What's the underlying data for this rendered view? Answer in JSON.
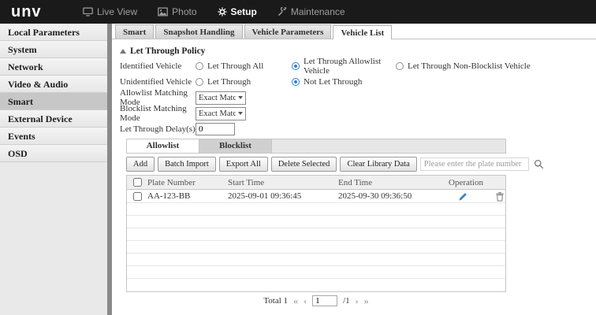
{
  "topbar": {
    "logo": "unv",
    "nav": [
      {
        "label": "Live View"
      },
      {
        "label": "Photo"
      },
      {
        "label": "Setup"
      },
      {
        "label": "Maintenance"
      }
    ]
  },
  "sidebar": {
    "items": [
      {
        "label": "Local Parameters"
      },
      {
        "label": "System"
      },
      {
        "label": "Network"
      },
      {
        "label": "Video & Audio"
      },
      {
        "label": "Smart"
      },
      {
        "label": "External Device"
      },
      {
        "label": "Events"
      },
      {
        "label": "OSD"
      }
    ]
  },
  "tabs": [
    {
      "label": "Smart"
    },
    {
      "label": "Snapshot Handling"
    },
    {
      "label": "Vehicle Parameters"
    },
    {
      "label": "Vehicle List"
    }
  ],
  "policy": {
    "title": "Let Through Policy",
    "identified": {
      "label": "Identified Vehicle",
      "options": [
        {
          "label": "Let Through All",
          "selected": false
        },
        {
          "label": "Let Through Allowlist Vehicle",
          "selected": true
        },
        {
          "label": "Let Through Non-Blocklist Vehicle",
          "selected": false
        }
      ]
    },
    "unidentified": {
      "label": "Unidentified Vehicle",
      "options": [
        {
          "label": "Let Through",
          "selected": false
        },
        {
          "label": "Not Let Through",
          "selected": true
        }
      ]
    },
    "allowlist_mode": {
      "label": "Allowlist Matching Mode",
      "value": "Exact Match"
    },
    "blocklist_mode": {
      "label": "Blocklist Matching Mode",
      "value": "Exact Match"
    },
    "delay": {
      "label": "Let Through Delay(s)",
      "value": "0"
    }
  },
  "list": {
    "tabs": [
      {
        "label": "Allowlist"
      },
      {
        "label": "Blocklist"
      }
    ],
    "toolbar": {
      "add": "Add",
      "batch_import": "Batch Import",
      "export_all": "Export All",
      "delete_selected": "Delete Selected",
      "clear_library": "Clear Library Data",
      "search_placeholder": "Please enter the plate number"
    },
    "table": {
      "headers": {
        "plate": "Plate Number",
        "start": "Start Time",
        "end": "End Time",
        "operation": "Operation"
      },
      "rows": [
        {
          "plate": "AA-123-BB",
          "start": "2025-09-01 09:36:45",
          "end": "2025-09-30 09:36:50"
        }
      ]
    },
    "pagination": {
      "total": "Total 1",
      "first": "«",
      "prev": "‹",
      "page": "1",
      "of": "/1",
      "next": "›",
      "last": "»"
    }
  },
  "colors": {
    "topbar": "#1a1a1a",
    "accent": "#2f7ed8",
    "edit_icon": "#3a86c8",
    "delete_icon": "#8a8a8a"
  }
}
